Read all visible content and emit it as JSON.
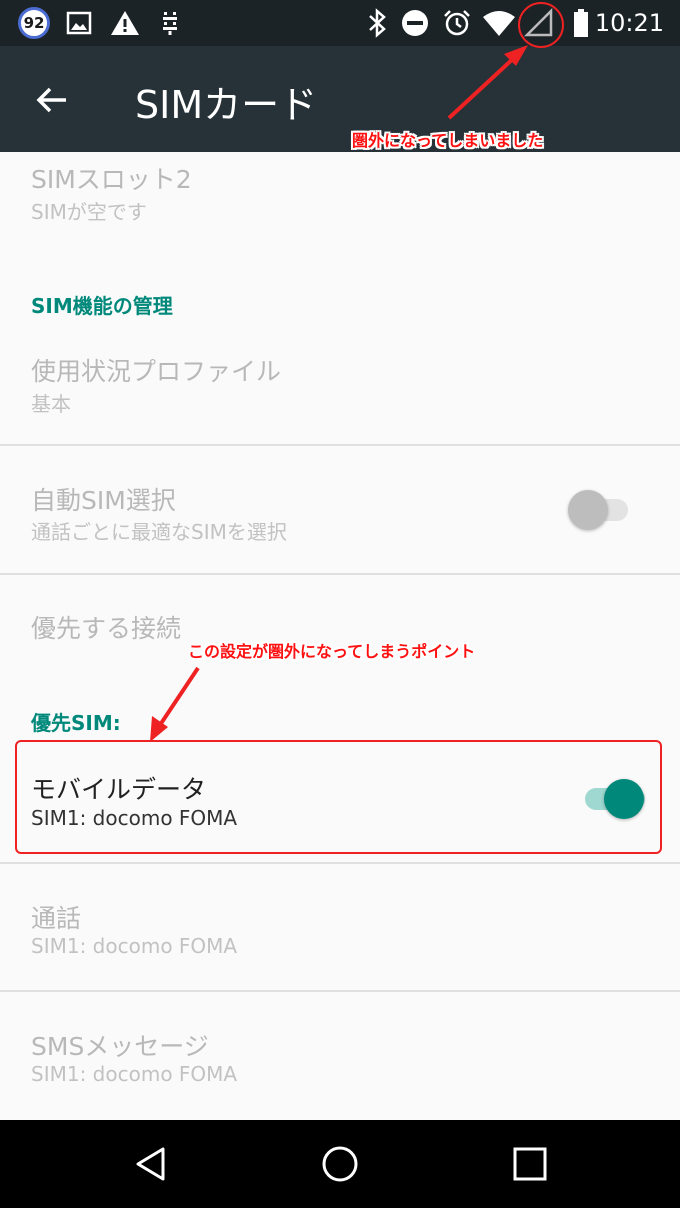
{
  "status_bar": {
    "notification_badge": "92",
    "time": "10:21",
    "icons": [
      "notification-count-icon",
      "image-icon",
      "warning-icon",
      "usb-debug-icon",
      "bluetooth-icon",
      "do-not-disturb-icon",
      "alarm-icon",
      "wifi-icon",
      "no-signal-icon",
      "battery-icon"
    ]
  },
  "toolbar": {
    "title": "SIMカード",
    "back_icon": "arrow-back-icon"
  },
  "items": [
    {
      "title": "SIMスロット2",
      "subtitle": "SIMが空です"
    },
    {
      "section": "SIM機能の管理"
    },
    {
      "title": "使用状況プロファイル",
      "subtitle": "基本"
    },
    {
      "title": "自動SIM選択",
      "subtitle": "通話ごとに最適なSIMを選択",
      "toggle": "off"
    },
    {
      "title": "優先する接続"
    },
    {
      "section": "優先SIM:"
    },
    {
      "title": "モバイルデータ",
      "subtitle": "SIM1: docomo FOMA",
      "toggle": "on"
    },
    {
      "title": "通話",
      "subtitle": "SIM1: docomo FOMA"
    },
    {
      "title": "SMSメッセージ",
      "subtitle": "SIM1: docomo FOMA"
    }
  ],
  "annotations": {
    "signal_note": "圏外になってしまいました",
    "setting_note": "この設定が圏外になってしまうポイント",
    "highlight_color": "#ee2222"
  },
  "colors": {
    "accent": "#00897b",
    "toolbar": "#263238",
    "status_bar": "#1b2327"
  },
  "nav_bar": [
    "back-triangle-icon",
    "home-circle-icon",
    "recents-square-icon"
  ]
}
